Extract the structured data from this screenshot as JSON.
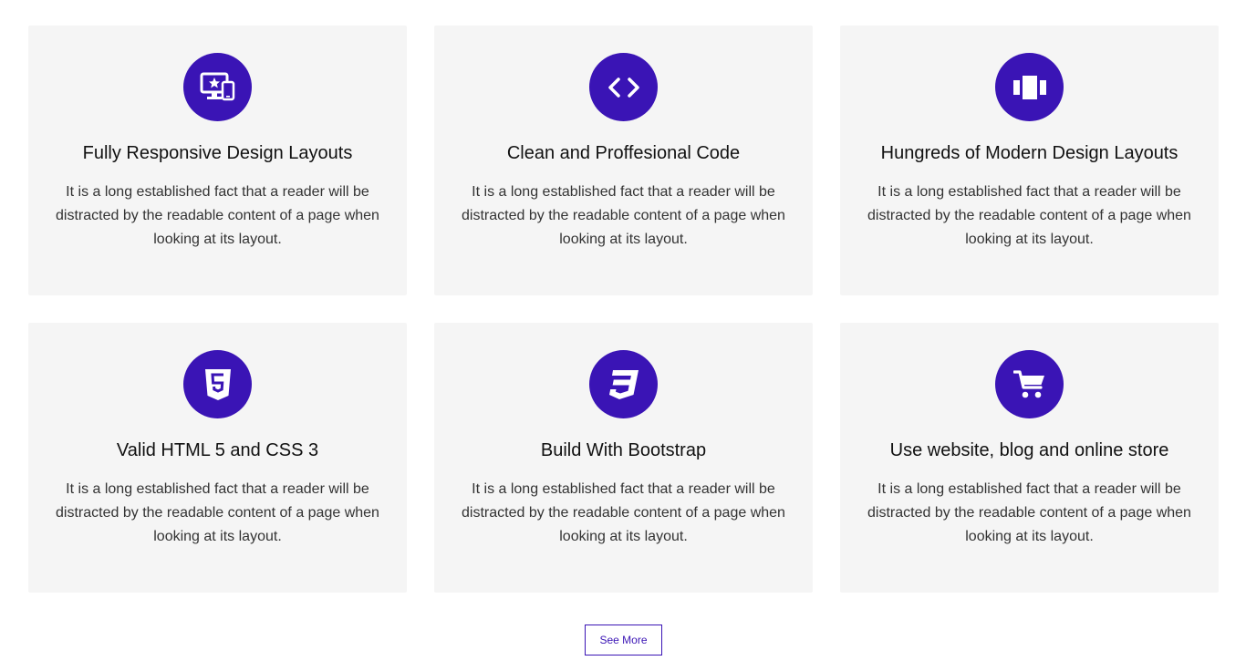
{
  "colors": {
    "accent": "#3a14b5",
    "card_bg": "#f5f5f5",
    "title": "#111111",
    "body_text": "#333333"
  },
  "features": [
    {
      "icon": "responsive-devices-icon",
      "title": "Fully Responsive Design Layouts",
      "text": "It is a long established fact that a reader will be distracted by the readable content of a page when looking at its layout."
    },
    {
      "icon": "code-icon",
      "title": "Clean and Proffesional Code",
      "text": "It is a long established fact that a reader will be distracted by the readable content of a page when looking at its layout."
    },
    {
      "icon": "layouts-icon",
      "title": "Hungreds of Modern Design Layouts",
      "text": "It is a long established fact that a reader will be distracted by the readable content of a page when looking at its layout."
    },
    {
      "icon": "html5-icon",
      "title": "Valid HTML 5 and CSS 3",
      "text": "It is a long established fact that a reader will be distracted by the readable content of a page when looking at its layout."
    },
    {
      "icon": "css3-icon",
      "title": "Build With Bootstrap",
      "text": "It is a long established fact that a reader will be distracted by the readable content of a page when looking at its layout."
    },
    {
      "icon": "shopping-cart-icon",
      "title": "Use website, blog and online store",
      "text": "It is a long established fact that a reader will be distracted by the readable content of a page when looking at its layout."
    }
  ],
  "see_more_label": "See More"
}
